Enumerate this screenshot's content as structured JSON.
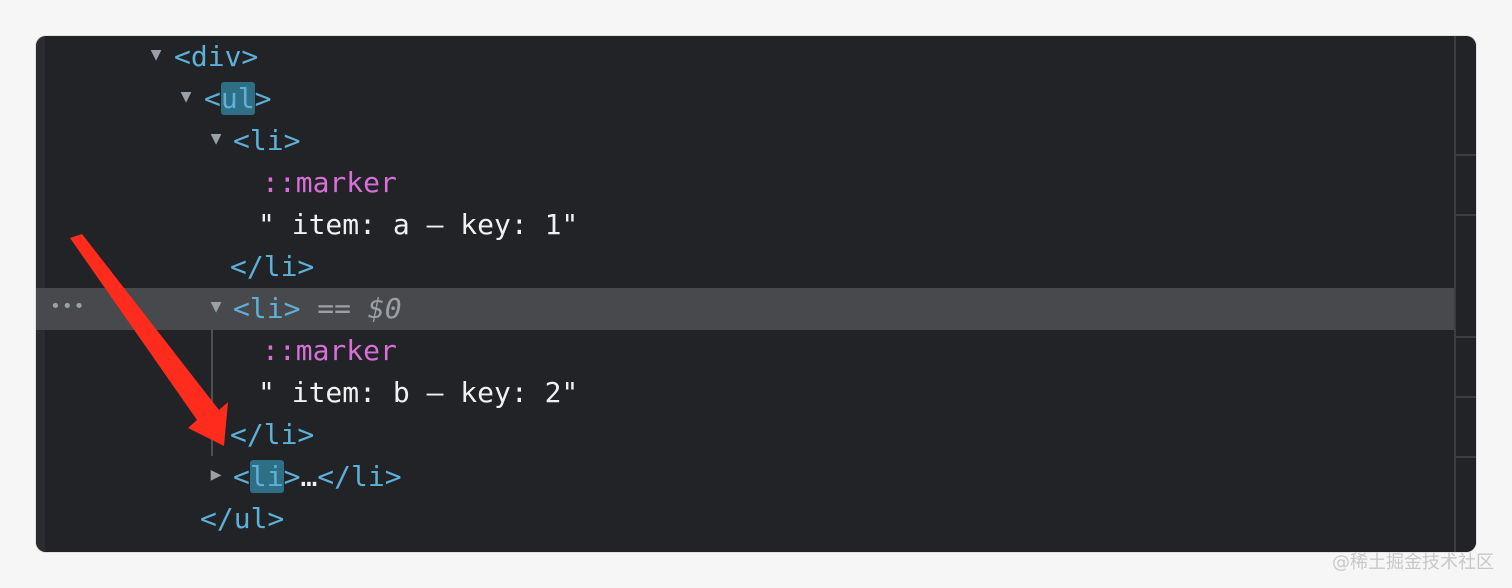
{
  "elements_tree": {
    "div_open": "<div>",
    "ul_open_lt": "<",
    "ul_tag": "ul",
    "ul_open_gt": ">",
    "li1_open": "<li>",
    "li1_marker": "::marker",
    "li1_text": "\" item: a – key: 1\"",
    "li1_close": "</li>",
    "li2_open": "<li>",
    "li2_eq": "==",
    "li2_ref": "$0",
    "li2_marker": "::marker",
    "li2_text": "\" item: b – key: 2\"",
    "li2_close": "</li>",
    "li3_lt": "<",
    "li3_tag": "li",
    "li3_gt": ">",
    "li3_ellipsis": "…",
    "li3_close": "</li>",
    "ul_close": "</ul>",
    "selected_row_menu": "•••"
  },
  "watermark": "@稀土掘金技术社区"
}
